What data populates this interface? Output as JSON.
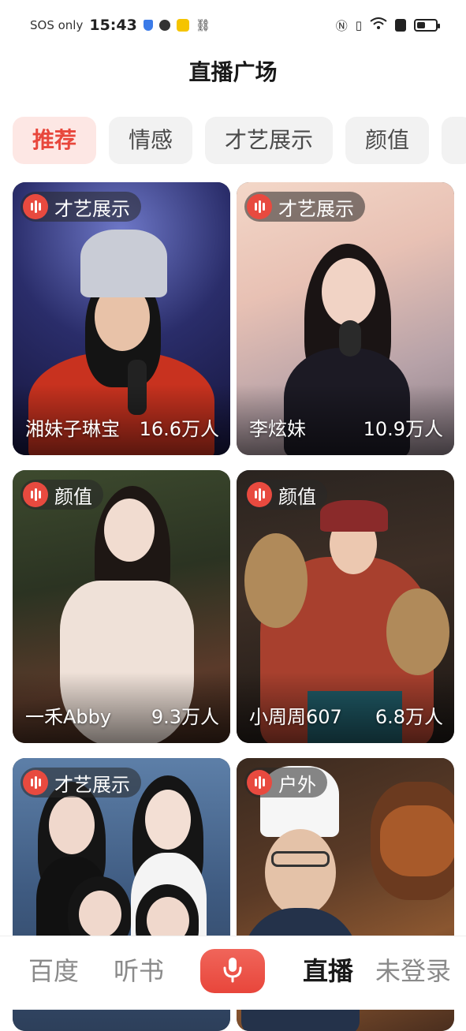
{
  "status_bar": {
    "carrier": "SOS only",
    "time": "15:43",
    "battery_level": 0.45
  },
  "header": {
    "title": "直播广场"
  },
  "tabs": [
    {
      "label": "推荐",
      "active": true
    },
    {
      "label": "情感",
      "active": false
    },
    {
      "label": "才艺展示",
      "active": false
    },
    {
      "label": "颜值",
      "active": false
    }
  ],
  "streams": [
    {
      "category": "才艺展示",
      "streamer": "湘妹子琳宝",
      "viewers": "16.6万人"
    },
    {
      "category": "才艺展示",
      "streamer": "李炫妹",
      "viewers": "10.9万人"
    },
    {
      "category": "颜值",
      "streamer": "一禾Abby",
      "viewers": "9.3万人"
    },
    {
      "category": "颜值",
      "streamer": "小周周607",
      "viewers": "6.8万人"
    },
    {
      "category": "才艺展示",
      "streamer": "",
      "viewers": ""
    },
    {
      "category": "户外",
      "streamer": "",
      "viewers": ""
    }
  ],
  "bottom_nav": {
    "baidu": "百度",
    "audiobook": "听书",
    "live": "直播",
    "login": "未登录"
  },
  "colors": {
    "accent": "#e8473c",
    "tab_active_bg": "#fde7e4",
    "tab_bg": "#f2f2f2"
  },
  "icons": [
    "sound-wave-icon",
    "microphone-icon",
    "battery-icon",
    "wifi-icon",
    "nfc-icon"
  ]
}
